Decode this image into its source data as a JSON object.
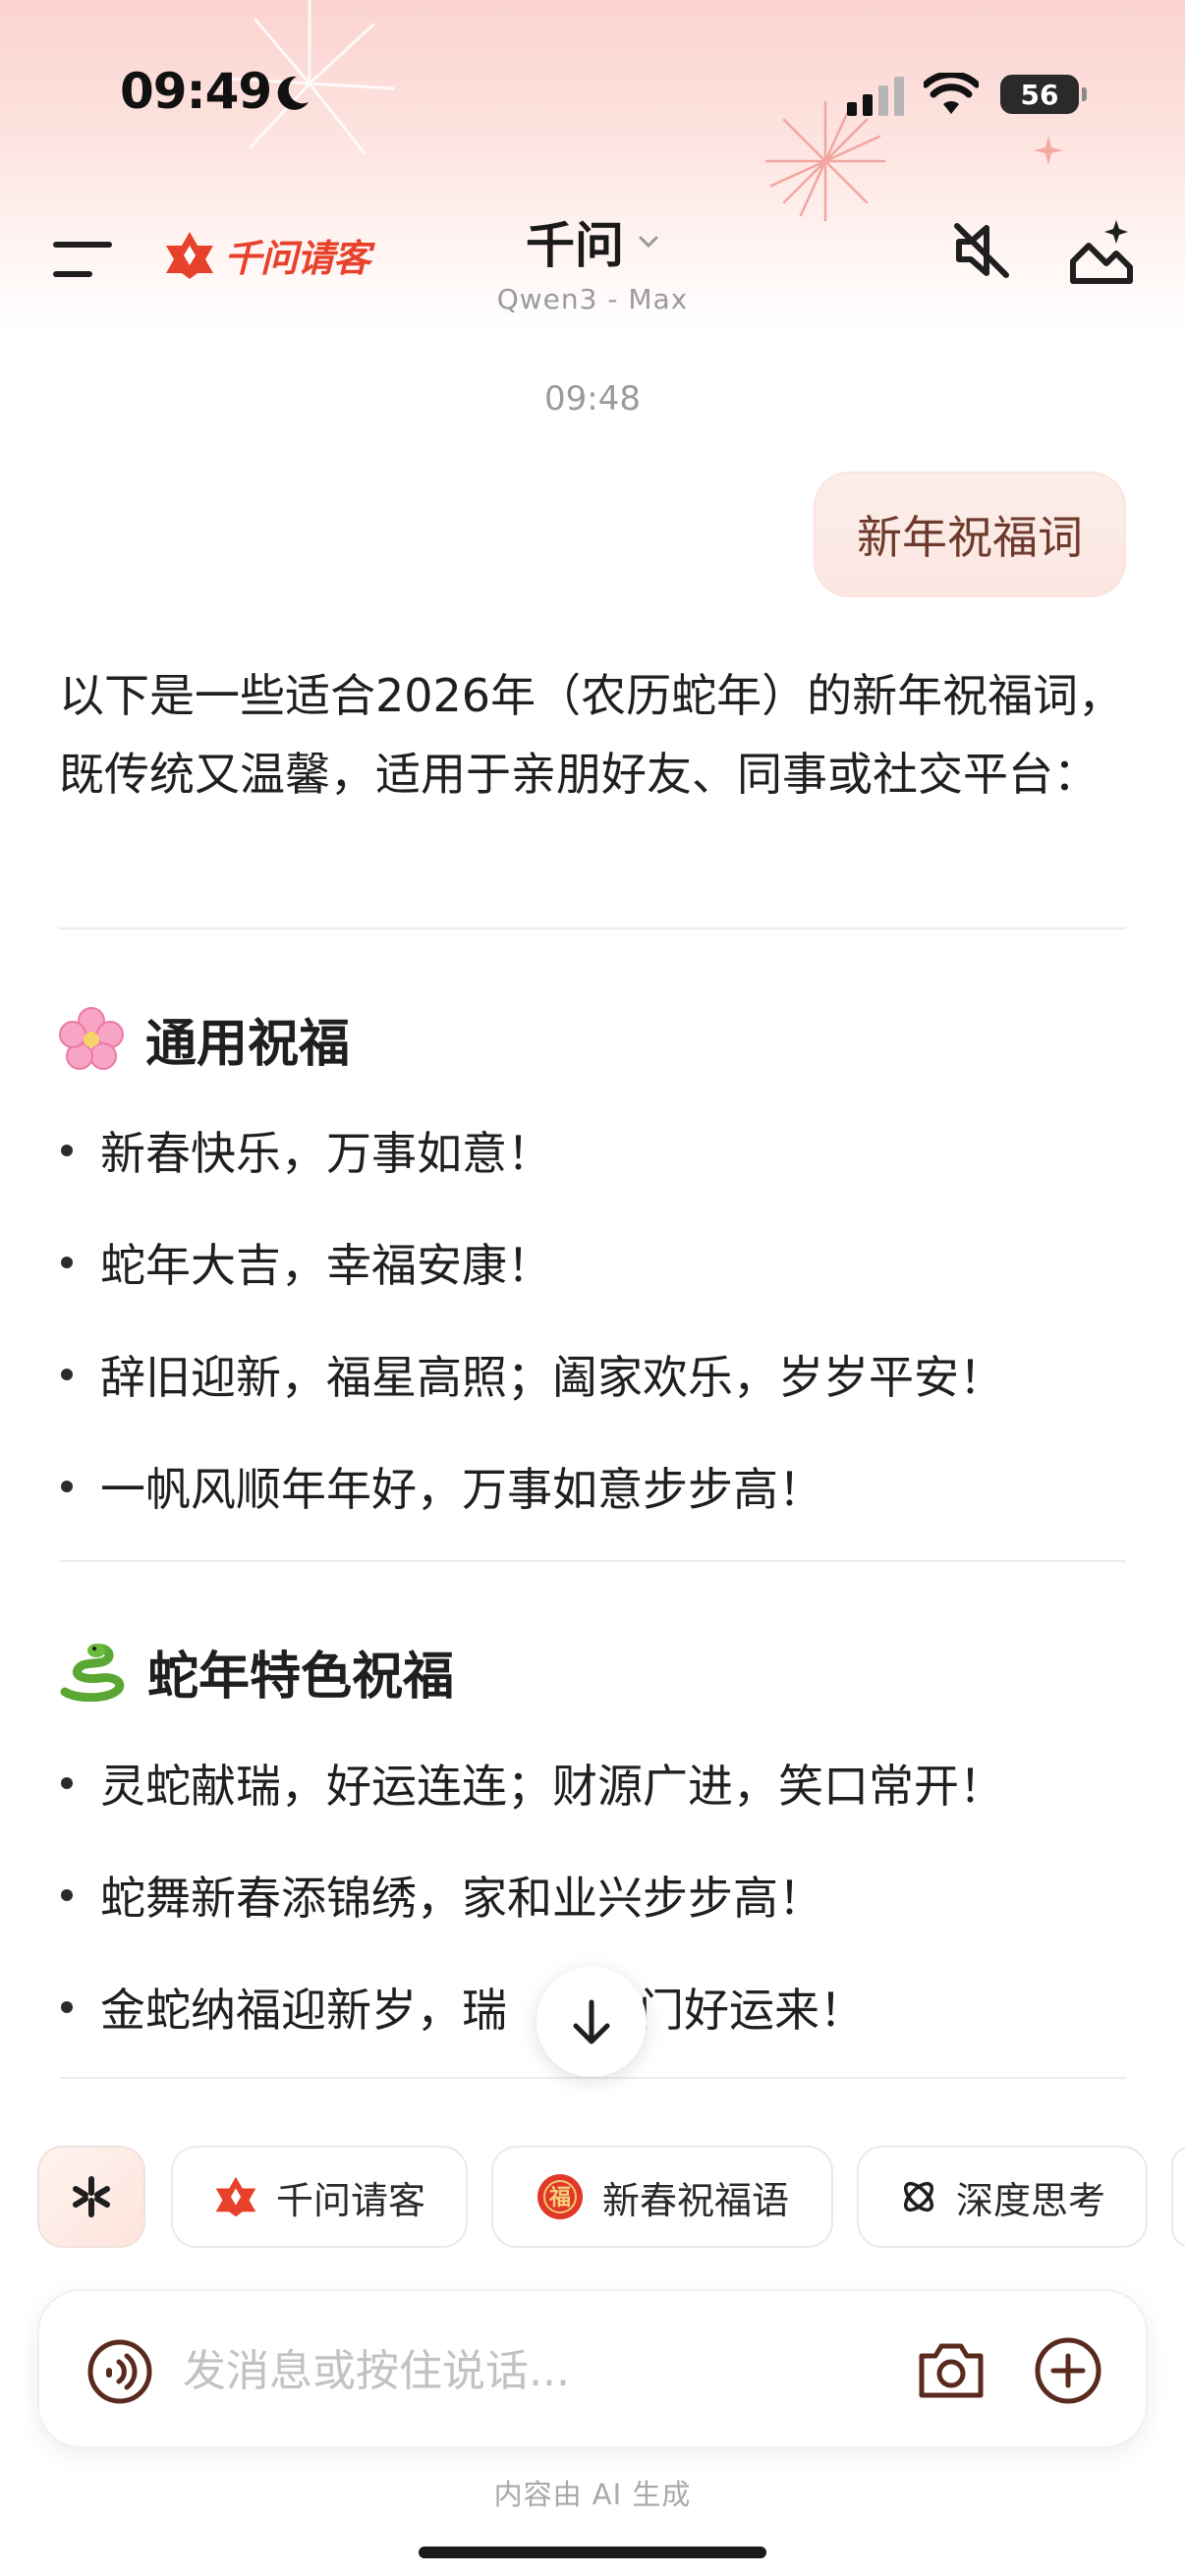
{
  "status_bar": {
    "time": "09:49",
    "battery": "56"
  },
  "header": {
    "brand_logo_text": "千问请客",
    "title": "千问",
    "model": "Qwen3 - Max"
  },
  "chat": {
    "timestamp": "09:48",
    "user_message": "新年祝福词",
    "answer_intro": "以下是一些适合2026年（农历蛇年）的新年祝福词，既传统又温馨，适用于亲朋好友、同事或社交平台：",
    "sections": [
      {
        "emoji": "cherry-blossom-emoji",
        "title": "通用祝福",
        "items": [
          "新春快乐，万事如意！",
          "蛇年大吉，幸福安康！",
          "辞旧迎新，福星高照；阖家欢乐，岁岁平安！",
          "一帆风顺年年好，万事如意步步高！"
        ]
      },
      {
        "emoji": "snake-emoji",
        "title": "蛇年特色祝福",
        "items": [
          "灵蛇献瑞，好运连连；财源广进，笑口常开！",
          "蛇舞新春添锦绣，家和业兴步步高！",
          "金蛇纳福迎新岁，瑞",
          "门好运来！"
        ]
      }
    ]
  },
  "chips": [
    {
      "label": "千问请客",
      "icon": "qwen-logo-icon"
    },
    {
      "label": "新春祝福语",
      "icon": "fu-icon"
    },
    {
      "label": "深度思考",
      "icon": "deep-think-icon"
    }
  ],
  "input": {
    "placeholder": "发消息或按住说话..."
  },
  "footer": {
    "note": "内容由 AI 生成"
  },
  "colors": {
    "brand": "#e8412b",
    "icon_dark": "#5a2a1f",
    "bubble": "#fbe6e1"
  }
}
